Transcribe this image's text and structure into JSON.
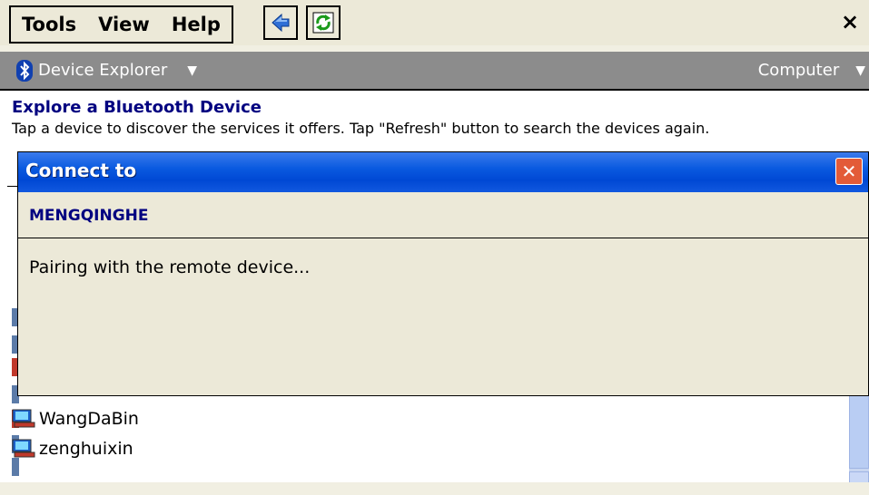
{
  "menu": {
    "items": [
      "Tools",
      "View",
      "Help"
    ],
    "back_icon": "back-arrow-icon",
    "refresh_icon": "refresh-icon",
    "close_label": "×"
  },
  "nav": {
    "app_icon": "bluetooth-icon",
    "title": "Device Explorer",
    "title_caret": "▼",
    "location": "Computer",
    "location_caret": "▼"
  },
  "page": {
    "heading": "Explore a Bluetooth Device",
    "description": "Tap a device to discover the services it offers. Tap \"Refresh\" button to search the devices again."
  },
  "devices": [
    {
      "name": "WangDaBin",
      "icon": "computer-icon"
    },
    {
      "name": "zenghuixin",
      "icon": "computer-icon"
    }
  ],
  "scrollbar": {
    "down_icon": "⌄"
  },
  "dialog": {
    "title": "Connect to",
    "close_label": "✕",
    "device_name": "MENGQINGHE",
    "status": "Pairing with the remote device..."
  },
  "colors": {
    "title_bar_blue": "#0a5ae0",
    "heading_navy": "#000080",
    "nav_gray": "#8c8c8c",
    "close_red": "#e35b38"
  }
}
